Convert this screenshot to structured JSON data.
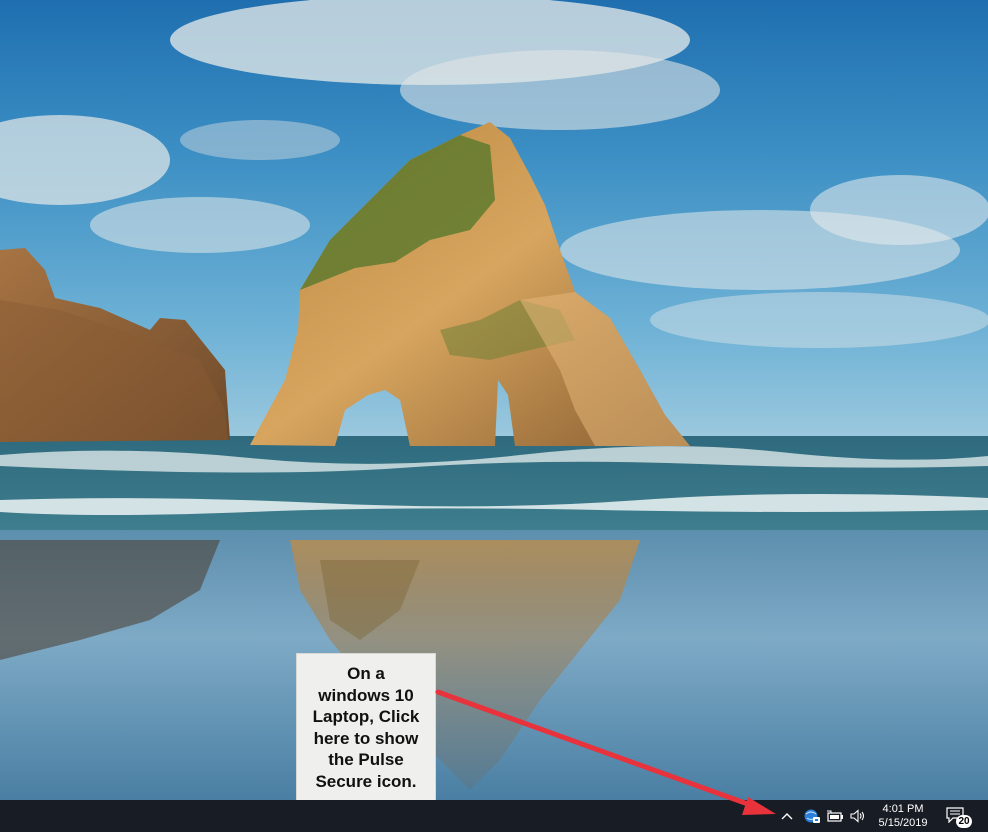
{
  "annotation": {
    "lines": [
      "On a",
      "windows 10",
      "Laptop, Click",
      "here to show",
      "the Pulse",
      "Secure icon."
    ]
  },
  "taskbar": {
    "clock": {
      "time": "4:01 PM",
      "date": "5/15/2019"
    },
    "notification_count": "20",
    "tray_icons": [
      "chevron-up-icon",
      "network-vpn-icon",
      "battery-power-icon",
      "volume-icon",
      "action-center-icon"
    ]
  },
  "colors": {
    "taskbar": "#181c24",
    "arrow": "#e8323c",
    "callout_bg": "#efefed"
  }
}
